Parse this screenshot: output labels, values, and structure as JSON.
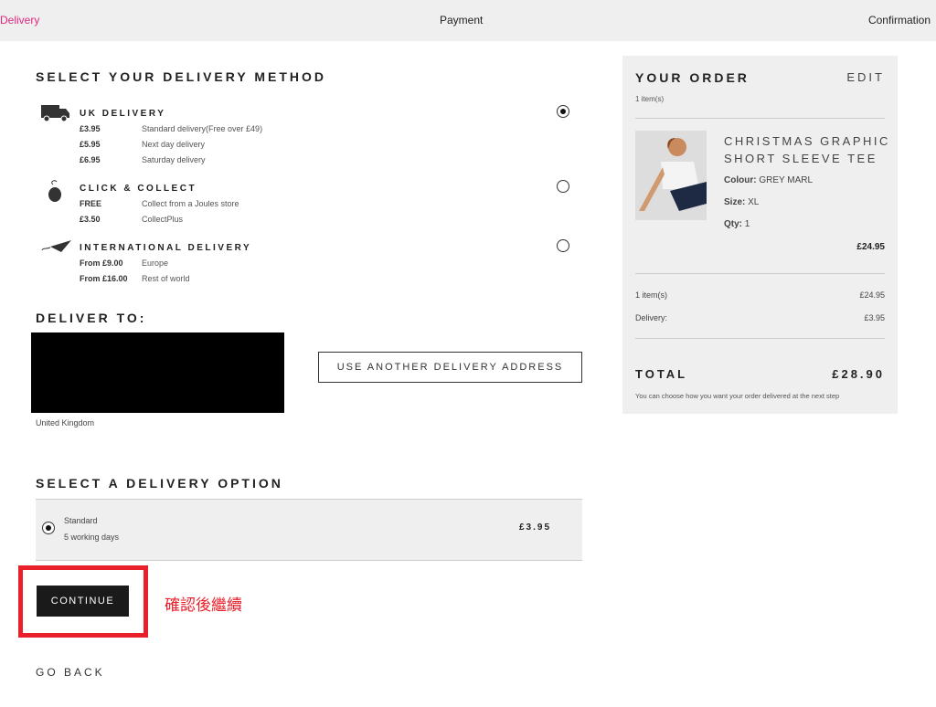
{
  "steps": {
    "delivery": "Delivery",
    "payment": "Payment",
    "confirmation": "Confirmation",
    "active_color": "#e0287d"
  },
  "method": {
    "title": "SELECT YOUR DELIVERY METHOD",
    "groups": [
      {
        "name": "UK DELIVERY",
        "icon": "truck-icon",
        "selected": true,
        "rows": [
          {
            "price": "£3.95",
            "desc": "Standard delivery(Free over £49)"
          },
          {
            "price": "£5.95",
            "desc": "Next day delivery"
          },
          {
            "price": "£6.95",
            "desc": "Saturday delivery"
          }
        ]
      },
      {
        "name": "CLICK & COLLECT",
        "icon": "mouse-icon",
        "selected": false,
        "rows": [
          {
            "price": "FREE",
            "desc": "Collect from a Joules store"
          },
          {
            "price": "£3.50",
            "desc": "CollectPlus"
          }
        ]
      },
      {
        "name": "INTERNATIONAL DELIVERY",
        "icon": "paper-plane-icon",
        "selected": false,
        "rows": [
          {
            "price": "From £9.00",
            "desc": "Europe"
          },
          {
            "price": "From £16.00",
            "desc": "Rest of world"
          }
        ]
      }
    ]
  },
  "deliver_to": {
    "title": "DELIVER TO:",
    "country": "United Kingdom",
    "another_button": "USE ANOTHER DELIVERY ADDRESS"
  },
  "option": {
    "title": "SELECT A DELIVERY OPTION",
    "name": "Standard",
    "days": "5 working days",
    "price": "£3.95",
    "selected": true
  },
  "continue_label": "CONTINUE",
  "annotation": "確認後繼續",
  "go_back": "GO BACK",
  "order": {
    "title": "YOUR ORDER",
    "edit": "EDIT",
    "count": "1 item(s)",
    "product": {
      "name1": "CHRISTMAS GRAPHIC",
      "name2": "SHORT SLEEVE TEE",
      "colour_label": "Colour:",
      "colour": "GREY MARL",
      "size_label": "Size:",
      "size": "XL",
      "qty_label": "Qty:",
      "qty": "1",
      "price": "£24.95"
    },
    "items_label": "1 item(s)",
    "items_value": "£24.95",
    "delivery_label": "Delivery:",
    "delivery_value": "£3.95",
    "total_label": "TOTAL",
    "total_value": "£28.90",
    "note": "You can choose how you want your order delivered at the next step"
  }
}
